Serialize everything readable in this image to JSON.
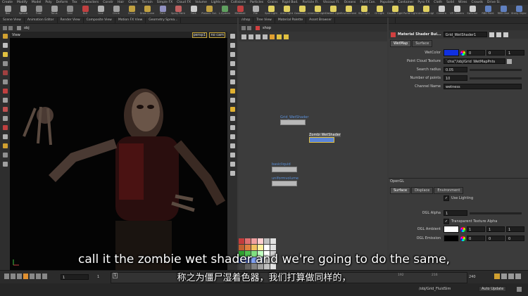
{
  "shelf": {
    "tabs": [
      "Create",
      "Modify",
      "Model",
      "Poly",
      "Deform",
      "Tex",
      "Characters",
      "Constr",
      "Hair",
      "Guide",
      "Terrain",
      "Simple FX",
      "Cloud FX",
      "Volume",
      "Lights an.",
      "Collisions",
      "Particles",
      "Grains",
      "Rigid Bod.",
      "Particle Fl.",
      "Viscous Fl.",
      "Oceans",
      "Fluid Con.",
      "Populate",
      "Container",
      "Pyro FX",
      "Cloth",
      "Solid",
      "Wires",
      "Crowds",
      "Drive Si."
    ],
    "tools": [
      {
        "label": "Box",
        "color": "#9a9a9a"
      },
      {
        "label": "Sphere",
        "color": "#b0b0b0"
      },
      {
        "label": "Tube",
        "color": "#8c8c8c"
      },
      {
        "label": "Torus",
        "color": "#a0a0a0"
      },
      {
        "label": "Grid",
        "color": "#8a8a8a"
      },
      {
        "label": "Null",
        "color": "#c04040"
      },
      {
        "label": "Line",
        "color": "#b0b0b0"
      },
      {
        "label": "Circle",
        "color": "#a0a0a0"
      },
      {
        "label": "Curve",
        "color": "#c0a040"
      },
      {
        "label": "Draw Curve",
        "color": "#c0a040"
      },
      {
        "label": "Path",
        "color": "#9090c0"
      },
      {
        "label": "Spray Paint",
        "color": "#c06060"
      },
      {
        "label": "Font",
        "color": "#cccccc"
      },
      {
        "label": "Platonic Sol.",
        "color": "#c0a040"
      },
      {
        "label": "L-System",
        "color": "#60a060"
      },
      {
        "label": "Metaball",
        "color": "#c04040"
      },
      {
        "label": "File",
        "color": "#b0b0b0"
      },
      {
        "label": "Spot Light",
        "color": "#e0d060"
      },
      {
        "label": "Area Light",
        "color": "#e0d060"
      },
      {
        "label": "Geometry Light",
        "color": "#e0d060"
      },
      {
        "label": "Volume Light",
        "color": "#e0d060"
      },
      {
        "label": "Distant Light",
        "color": "#e0d060"
      },
      {
        "label": "Environment",
        "color": "#e0d060"
      },
      {
        "label": "Sky Light",
        "color": "#e0d060"
      },
      {
        "label": "GI Light",
        "color": "#e0d060"
      },
      {
        "label": "Caustic Light",
        "color": "#e0d060"
      },
      {
        "label": "Portal Light",
        "color": "#e0d060"
      },
      {
        "label": "Ambient Light",
        "color": "#e0d060"
      },
      {
        "label": "Camera",
        "color": "#cfcfcf"
      },
      {
        "label": "VR Camera",
        "color": "#cfcfcf"
      },
      {
        "label": "Switcher",
        "color": "#cfcfcf"
      },
      {
        "label": "RBD Point",
        "color": "#6080c0"
      },
      {
        "label": "RBD Glue",
        "color": "#6080c0"
      },
      {
        "label": "Sticky Object",
        "color": "#6080c0"
      }
    ]
  },
  "left_pane": {
    "tabs": [
      "Scene View",
      "Animation Editor",
      "Render View",
      "Composite View",
      "Motion FX View",
      "Geometry Sprea..."
    ],
    "path": "obj",
    "view_label": "View",
    "camera_menu": "persp1",
    "cam_menu": "no cam"
  },
  "center_pane": {
    "tabs": [
      "/shop",
      "Tree View",
      "Material Palette",
      "Asset Browser"
    ],
    "path": "shop",
    "nodes": [
      {
        "label": "Grid_WetShader"
      },
      {
        "label": "Zombi WetShader"
      },
      {
        "label": "basicliquid"
      },
      {
        "label": "uniformvolume"
      }
    ],
    "swatch_colors": [
      "#c43c3c",
      "#e07070",
      "#f0a0a0",
      "#ffd0d0",
      "#c0c0c0",
      "#e0e0e0",
      "#c06030",
      "#e08040",
      "#f0c060",
      "#fff0a0",
      "#ffffff",
      "#e0e0e0",
      "#30a030",
      "#50c050",
      "#80e080",
      "#c0ffc0",
      "#ffffff",
      "#d0d0d0",
      "#3050c0",
      "#5070e0",
      "#80a0f0",
      "#c0d0ff",
      "#f0f0f0",
      "#a0a0a0",
      "#404040",
      "#606060",
      "#808080",
      "#a0a0a0",
      "#c0c0c0",
      "#e0e0e0"
    ]
  },
  "right_pane": {
    "title": "Material Shader Bui...",
    "node_name": "Grid_WetShader1",
    "tabs": [
      "WetMap",
      "Surface"
    ],
    "params": {
      "wetcolor_label": "WetColor",
      "wetcolor_color": "#1030e0",
      "wetcolor_g": "0",
      "wetcolor_b": "0",
      "wetcolor_a": "1",
      "pointcloud_label": "Point Cloud Texture",
      "pointcloud_value": "`chs(\"/obj/Grid_WetMapPnts",
      "radius_label": "Search radius",
      "radius_value": "0.05",
      "points_label": "Number of points",
      "points_value": "10",
      "channel_label": "Channel Name",
      "channel_value": "wetness"
    },
    "opengl_title": "OpenGL",
    "opengl_tabs": [
      "Surface",
      "Displace",
      "Environment"
    ],
    "use_lighting": "Use Lighting",
    "ogl_alpha_label": "OGL Alpha",
    "ogl_alpha_value": "1",
    "transparent_label": "Transparent Texture Alpha",
    "ogl_ambient_label": "OGL Ambient",
    "ogl_ambient_values": [
      "1",
      "1",
      "1"
    ],
    "ogl_ambient_color": "#ffffff",
    "ogl_emission_label": "OGL Emission",
    "ogl_emission_values": [
      "0",
      "0",
      "0"
    ],
    "ogl_emission_color": "#000000"
  },
  "timeline": {
    "frame": "1",
    "start": "1",
    "start2": "1",
    "end": "240",
    "end2": "240",
    "ticks": [
      "192",
      "216"
    ],
    "playhead_label": "1"
  },
  "status": {
    "path": "/obj/Grid_FluidSim",
    "update_mode": "Auto Update"
  },
  "subtitles": {
    "english": "call it the zombie wet shader and we're going to do the same,",
    "chinese": "称之为僵尸湿着色器，我们打算做同样的，"
  }
}
